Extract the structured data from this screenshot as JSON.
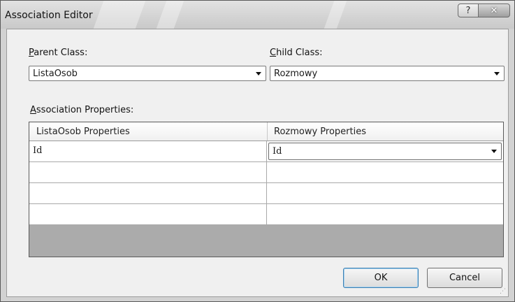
{
  "window": {
    "title": "Association Editor",
    "help_label": "?",
    "close_label": "✕"
  },
  "parent": {
    "label_key": "P",
    "label_rest": "arent Class:",
    "value": "ListaOsob"
  },
  "child": {
    "label_key": "C",
    "label_rest": "hild Class:",
    "value": "Rozmowy"
  },
  "assoc": {
    "label_key": "A",
    "label_rest": "ssociation Properties:"
  },
  "grid": {
    "columns": [
      "ListaOsob Properties",
      "Rozmowy Properties"
    ],
    "rows": [
      {
        "parent": "Id",
        "child": "Id"
      },
      {
        "parent": "",
        "child": ""
      },
      {
        "parent": "",
        "child": ""
      },
      {
        "parent": "",
        "child": ""
      }
    ]
  },
  "buttons": {
    "ok": "OK",
    "cancel": "Cancel"
  }
}
